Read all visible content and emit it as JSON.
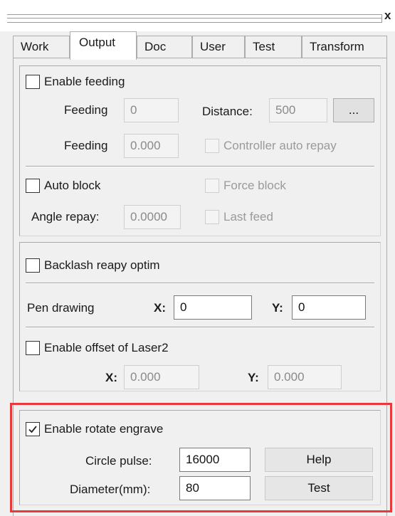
{
  "window": {
    "close_glyph": "x"
  },
  "tabs": [
    {
      "label": "Work",
      "active": false
    },
    {
      "label": "Output",
      "active": true
    },
    {
      "label": "Doc",
      "active": false
    },
    {
      "label": "User",
      "active": false
    },
    {
      "label": "Test",
      "active": false
    },
    {
      "label": "Transform",
      "active": false
    }
  ],
  "feeding": {
    "enable_label": "Enable feeding",
    "enabled": false,
    "feeding_label": "Feeding",
    "feeding_value": "0",
    "distance_label": "Distance:",
    "distance_value": "500",
    "more_button": "...",
    "feeding2_label": "Feeding",
    "feeding2_value": "0.000",
    "controller_auto_repay_label": "Controller auto repay",
    "controller_auto_repay_checked": false
  },
  "block": {
    "auto_block_label": "Auto block",
    "auto_block_checked": false,
    "force_block_label": "Force block",
    "force_block_checked": false,
    "angle_repay_label": "Angle repay:",
    "angle_repay_value": "0.0000",
    "last_feed_label": "Last feed",
    "last_feed_checked": false
  },
  "backlash": {
    "label": "Backlash reapy optim",
    "checked": false
  },
  "pen_drawing": {
    "label": "Pen drawing",
    "x_label": "X:",
    "x_value": "0",
    "y_label": "Y:",
    "y_value": "0"
  },
  "laser2_offset": {
    "label": "Enable offset of Laser2",
    "checked": false,
    "x_label": "X:",
    "x_value": "0.000",
    "y_label": "Y:",
    "y_value": "0.000"
  },
  "rotate_engrave": {
    "label": "Enable rotate engrave",
    "checked": true,
    "circle_pulse_label": "Circle pulse:",
    "circle_pulse_value": "16000",
    "help_button": "Help",
    "diameter_label": "Diameter(mm):",
    "diameter_value": "80",
    "test_button": "Test"
  },
  "colors": {
    "highlight_border": "#e8393c",
    "panel_bg": "#f0f0f0",
    "disabled_text": "#9a9a9a"
  }
}
